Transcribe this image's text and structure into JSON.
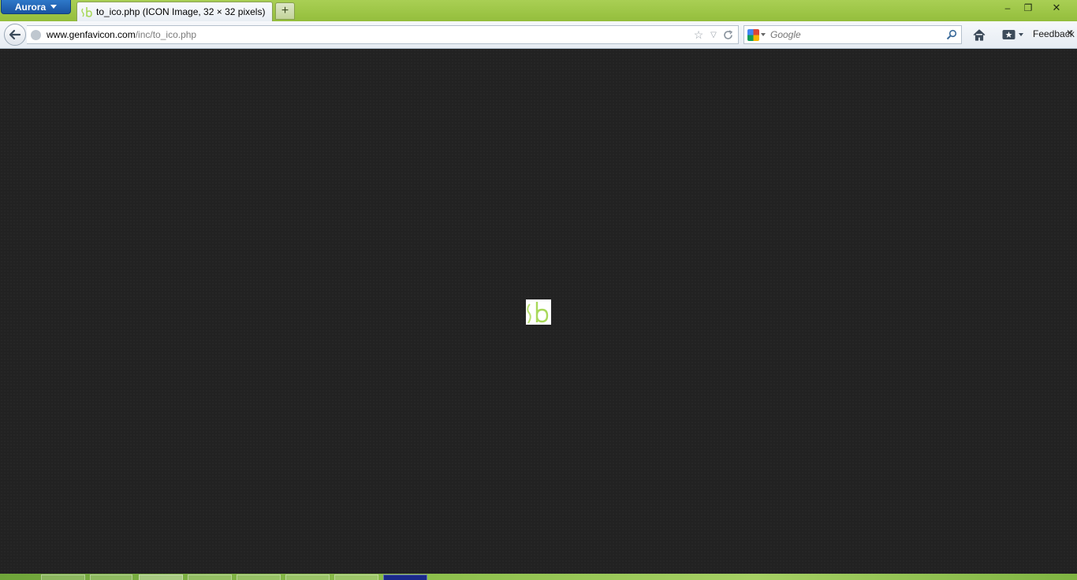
{
  "browser": {
    "app_menu_label": "Aurora",
    "tab": {
      "title": "to_ico.php (ICON Image, 32 × 32 pixels)",
      "favicon": "sb-logo"
    },
    "new_tab_label": "+",
    "window_controls": {
      "minimize": "–",
      "restore": "❐",
      "close": "✕"
    }
  },
  "navbar": {
    "url_domain": "www.genfavicon.com",
    "url_path": "/inc/to_ico.php",
    "search": {
      "engine": "Google",
      "placeholder": "Google"
    },
    "feedback_label": "Feedback"
  },
  "content": {
    "image_logo_text": "sb",
    "background_color": "#222222",
    "logo_color": "#a8d85a"
  },
  "colors": {
    "accent": "#93bd3b",
    "app_button": "#1f5fb0"
  },
  "taskbar": {
    "items": [
      "file-explorer-icon",
      "chrome-icon",
      "firefox-icon",
      "opera-icon",
      "notes-icon",
      "ie-icon",
      "media-icon",
      "app-icon"
    ]
  }
}
